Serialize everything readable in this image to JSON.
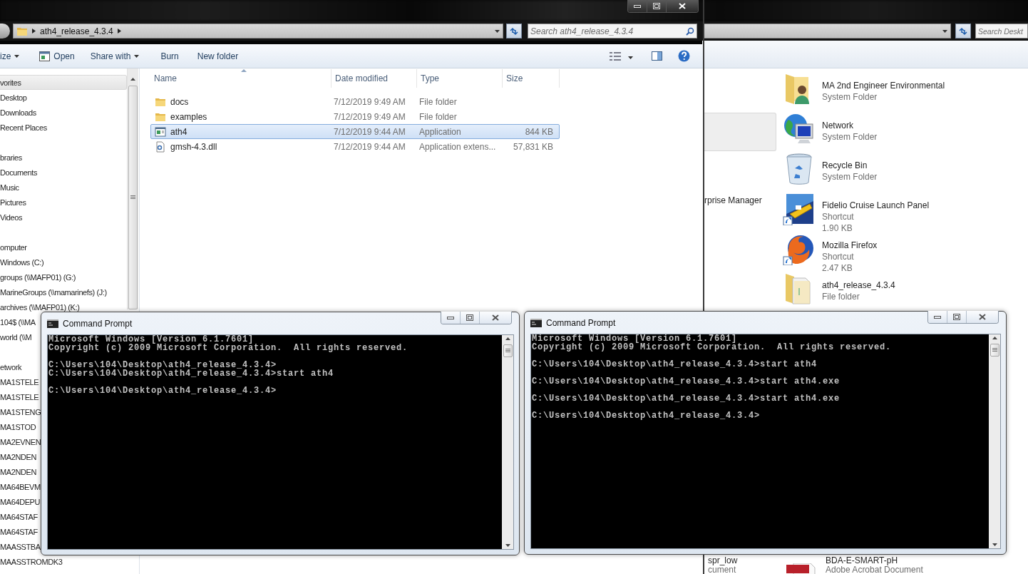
{
  "explorer": {
    "address": {
      "crumbs": [
        "ath4_release_4.3.4"
      ]
    },
    "search": {
      "placeholder": "Search ath4_release_4.3.4"
    },
    "toolbar": [
      {
        "label": "ize",
        "kind": "menu"
      },
      {
        "label": "Open",
        "kind": "open"
      },
      {
        "label": "Share with",
        "kind": "menu"
      },
      {
        "label": "Burn",
        "kind": "plain"
      },
      {
        "label": "New folder",
        "kind": "plain"
      }
    ],
    "nav": [
      {
        "label": "vorites",
        "selected": true,
        "children": [
          {
            "label": "Desktop",
            "selected": false
          },
          {
            "label": "Downloads",
            "selected": false
          },
          {
            "label": "Recent Places",
            "selected": false
          }
        ]
      },
      {
        "label": "braries",
        "selected": false,
        "children": [
          {
            "label": "Documents",
            "selected": false
          },
          {
            "label": "Music",
            "selected": false
          },
          {
            "label": "Pictures",
            "selected": false
          },
          {
            "label": "Videos",
            "selected": false
          }
        ]
      },
      {
        "label": "omputer",
        "selected": false,
        "children": [
          {
            "label": "Windows (C:)",
            "selected": false
          },
          {
            "label": "groups (\\\\MAFP01) (G:)",
            "selected": false
          },
          {
            "label": "MarineGroups (\\\\mamarinefs) (J:)",
            "selected": false
          },
          {
            "label": "archives (\\\\MAFP01) (K:)",
            "selected": false
          },
          {
            "label": "104$ (\\\\MA",
            "selected": false
          },
          {
            "label": "world (\\\\M",
            "selected": false
          }
        ]
      },
      {
        "label": "etwork",
        "selected": false,
        "children": [
          {
            "label": "MA1STELE",
            "selected": false
          },
          {
            "label": "MA1STELE",
            "selected": false
          },
          {
            "label": "MA1STENG",
            "selected": false
          },
          {
            "label": "MA1STOD",
            "selected": false
          },
          {
            "label": "MA2EVNEN",
            "selected": false
          },
          {
            "label": "MA2NDEN",
            "selected": false
          },
          {
            "label": "MA2NDEN",
            "selected": false
          },
          {
            "label": "MA64BEVM",
            "selected": false
          },
          {
            "label": "MA64DEPU",
            "selected": false
          },
          {
            "label": "MA64STAF",
            "selected": false
          },
          {
            "label": "MA64STAF",
            "selected": false
          },
          {
            "label": "MAASSTBA",
            "selected": false
          },
          {
            "label": "MAASSTROMDK3",
            "selected": false
          }
        ]
      }
    ],
    "columns": [
      {
        "label": "Name",
        "sorted": true
      },
      {
        "label": "Date modified",
        "sorted": false
      },
      {
        "label": "Type",
        "sorted": false
      },
      {
        "label": "Size",
        "sorted": false
      }
    ],
    "files": [
      {
        "name": "docs",
        "date": "7/12/2019 9:49 AM",
        "type": "File folder",
        "kind": "folder",
        "selected": false
      },
      {
        "name": "examples",
        "date": "7/12/2019 9:49 AM",
        "type": "File folder",
        "kind": "folder",
        "selected": false
      },
      {
        "name": "ath4",
        "date": "7/12/2019 9:44 AM",
        "type": "Application",
        "size": "844 KB",
        "kind": "app",
        "selected": true
      },
      {
        "name": "gmsh-4.3.dll",
        "date": "7/12/2019 9:44 AM",
        "type": "Application extens...",
        "size": "57,831 KB",
        "kind": "dll",
        "selected": false
      }
    ]
  },
  "desktop_window": {
    "search": {
      "placeholder": "Search Deskt"
    },
    "items": [
      {
        "name": "MA 2nd Engineer Environmental",
        "details": [
          "System Folder"
        ],
        "kind": "user-folder"
      },
      {
        "name": "Network",
        "details": [
          "System Folder"
        ],
        "kind": "network"
      },
      {
        "name": "Recycle Bin",
        "details": [
          "System Folder"
        ],
        "kind": "recycle"
      },
      {
        "name": "Fidelio Cruise Launch Panel",
        "details": [
          "Shortcut",
          "1.90 KB"
        ],
        "kind": "ship"
      },
      {
        "name": "Mozilla Firefox",
        "details": [
          "Shortcut",
          "2.47 KB"
        ],
        "kind": "firefox"
      },
      {
        "name": "ath4_release_4.3.4",
        "details": [
          "File folder"
        ],
        "kind": "folder"
      }
    ],
    "left_column": [
      {
        "name": "rprise Manager"
      }
    ],
    "bottom_left": {
      "name": "spr_low",
      "detail": "cument"
    },
    "bottom_right": {
      "name": "BDA-E-SMART-pH",
      "detail": "Adobe Acrobat Document",
      "kind": "pdf"
    }
  },
  "consoles": [
    {
      "title": "Command Prompt",
      "lines": [
        {
          "text": "Microsoft Windows [Version 6.1.7601]",
          "blank_before": false
        },
        {
          "text": "Copyright (c) 2009 Microsoft Corporation.  All rights reserved.",
          "blank_before": false
        },
        {
          "text": "C:\\Users\\104\\Desktop\\ath4_release_4.3.4>",
          "blank_before": true
        },
        {
          "text": "C:\\Users\\104\\Desktop\\ath4_release_4.3.4>start ath4",
          "blank_before": false
        },
        {
          "text": "C:\\Users\\104\\Desktop\\ath4_release_4.3.4>",
          "blank_before": true
        }
      ]
    },
    {
      "title": "Command Prompt",
      "lines": [
        {
          "text": "Microsoft Windows [Version 6.1.7601]",
          "blank_before": false
        },
        {
          "text": "Copyright (c) 2009 Microsoft Corporation.  All rights reserved.",
          "blank_before": false
        },
        {
          "text": "C:\\Users\\104\\Desktop\\ath4_release_4.3.4>start ath4",
          "blank_before": true
        },
        {
          "text": "C:\\Users\\104\\Desktop\\ath4_release_4.3.4>start ath4.exe",
          "blank_before": true
        },
        {
          "text": "C:\\Users\\104\\Desktop\\ath4_release_4.3.4>start ath4.exe",
          "blank_before": true
        },
        {
          "text": "C:\\Users\\104\\Desktop\\ath4_release_4.3.4>",
          "blank_before": true
        }
      ]
    }
  ]
}
